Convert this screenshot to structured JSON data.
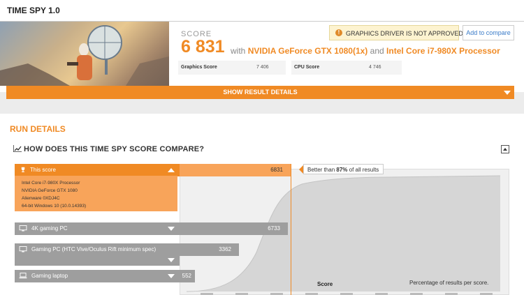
{
  "header": {
    "title": "TIME SPY 1.0",
    "score_label": "SCORE",
    "score_value": "6 831",
    "with_text": "with",
    "gpu": "NVIDIA GeForce GTX 1080(1x)",
    "and_text": "and",
    "cpu": "Intel Core i7-980X Processor",
    "warning": "GRAPHICS DRIVER IS NOT APPROVED",
    "compare_button": "Add to compare",
    "graphics_label": "Graphics Score",
    "graphics_value": "7 406",
    "cpu_label": "CPU Score",
    "cpu_value": "4 746",
    "show_details": "SHOW RESULT DETAILS"
  },
  "run": {
    "title": "RUN DETAILS",
    "compare_title": "HOW DOES THIS TIME SPY SCORE COMPARE?",
    "x_label": "Score",
    "pct_label": "Percentage of results per score.",
    "better_prefix": "Better than",
    "better_pct": "87%",
    "better_suffix": "of all results",
    "rows": [
      {
        "label": "This score",
        "score": "6831"
      },
      {
        "label": "4K gaming PC",
        "score": "6733"
      },
      {
        "label": "Gaming PC (HTC Vive/Oculus Rift minimum spec)",
        "score": "3362"
      },
      {
        "label": "Gaming laptop",
        "score": "552"
      }
    ],
    "details": [
      "Intel Core i7-980X Processor",
      "NVIDIA GeForce GTX 1080",
      "Alienware 0XDJ4C",
      "64-bit Windows 10 (10.0.14393)"
    ]
  },
  "colors": {
    "accent": "#f08a24",
    "gray_bar": "#9e9e9e",
    "warning_bg": "#fdf3d0",
    "link": "#3a7bc8"
  }
}
